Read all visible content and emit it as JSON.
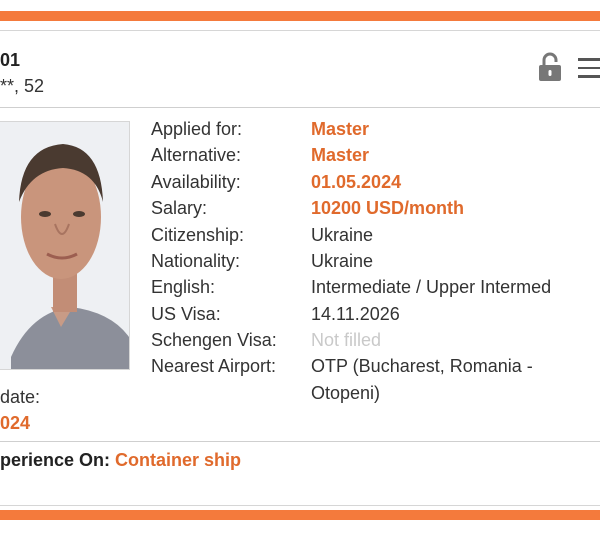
{
  "colors": {
    "accent": "#f47a3c",
    "highlight": "#e06a2c",
    "muted": "#c9c9c9"
  },
  "header": {
    "id_fragment": "01",
    "subtitle_fragment": "**, 52",
    "lock_icon": "lock-icon",
    "menu_icon": "menu-icon"
  },
  "details": {
    "applied_for_label": "Applied for:",
    "applied_for_value": "Master",
    "alternative_label": "Alternative:",
    "alternative_value": "Master",
    "availability_label": "Availability:",
    "availability_value": "01.05.2024",
    "salary_label": "Salary:",
    "salary_value": "10200 USD/month",
    "citizenship_label": "Citizenship:",
    "citizenship_value": "Ukraine",
    "nationality_label": "Nationality:",
    "nationality_value": "Ukraine",
    "english_label": "English:",
    "english_value": "Intermediate / Upper Intermed",
    "us_visa_label": "US Visa:",
    "us_visa_value": "14.11.2026",
    "schengen_label": "Schengen Visa:",
    "schengen_value": "Not filled",
    "airport_label": "Nearest Airport:",
    "airport_value_line1": "OTP (Bucharest, Romania -",
    "airport_value_line2": "Otopeni)"
  },
  "update": {
    "label_fragment": "date:",
    "value_fragment": "024"
  },
  "experience": {
    "label_fragment": "perience On:",
    "value": "Container ship"
  }
}
